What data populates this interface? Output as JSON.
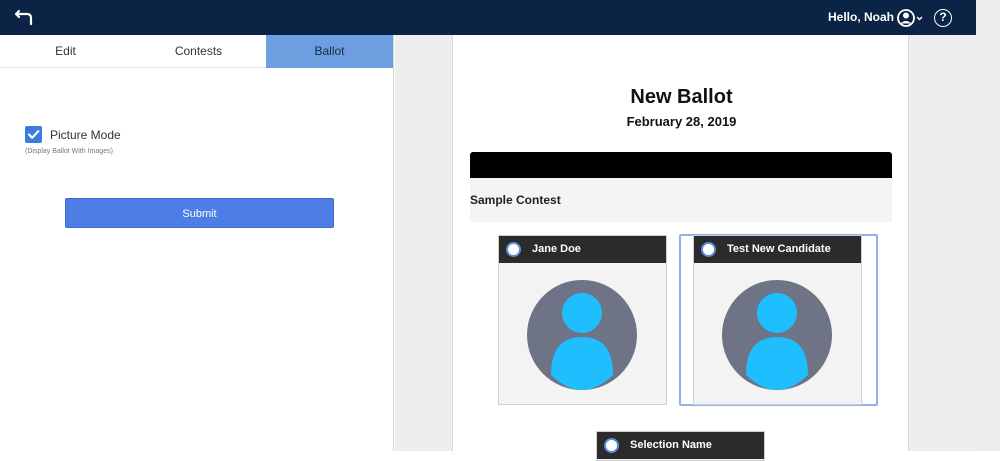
{
  "header": {
    "greeting": "Hello, Noah",
    "icons": {
      "back": "back-arrow-icon",
      "user": "user-circle-icon",
      "help": "help-icon"
    },
    "help_glyph": "?"
  },
  "left_panel": {
    "tabs": [
      {
        "label": "Edit",
        "active": false
      },
      {
        "label": "Contests",
        "active": false
      },
      {
        "label": "Ballot",
        "active": true
      }
    ],
    "picture_mode": {
      "label": "Picture Mode",
      "hint": "(Display Ballot With Images)",
      "checked": true
    },
    "submit_label": "Submit"
  },
  "ballot": {
    "title": "New Ballot",
    "date": "February 28, 2019",
    "contest": {
      "title": "Sample Contest",
      "candidates": [
        {
          "name": "Jane Doe",
          "selected": false,
          "focused": false
        },
        {
          "name": "Test New Candidate",
          "selected": false,
          "focused": true
        },
        {
          "name": "Selection Name",
          "selected": false,
          "focused": false
        }
      ]
    }
  },
  "colors": {
    "topbar": "#0b2446",
    "active_tab": "#6d9fe0",
    "submit": "#4f7de6",
    "avatar_circle": "#6f7386",
    "avatar_figure": "#1fbfff"
  }
}
